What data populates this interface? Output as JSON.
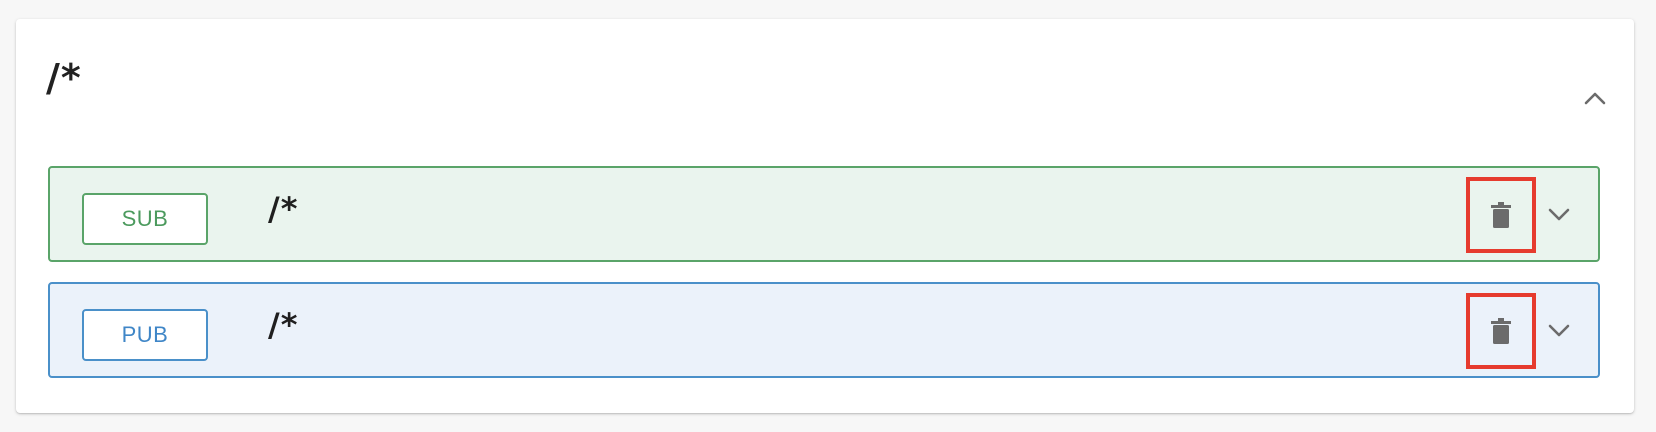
{
  "card": {
    "title": "/*",
    "collapse_icon": "chevron-up-icon"
  },
  "rows": [
    {
      "badge": "SUB",
      "topic": "/*",
      "delete_icon": "trash-icon",
      "expand_icon": "chevron-down-icon",
      "accent": "#5aa469",
      "background": "#eaf4ee"
    },
    {
      "badge": "PUB",
      "topic": "/*",
      "delete_icon": "trash-icon",
      "expand_icon": "chevron-down-icon",
      "accent": "#4a90c9",
      "background": "#ebf2fa"
    }
  ],
  "colors": {
    "highlight": "#e63b2e",
    "icon": "#6b6b6b"
  }
}
